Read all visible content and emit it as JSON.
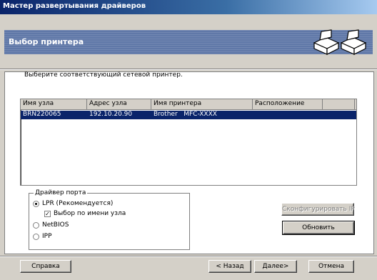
{
  "window": {
    "title": "Мастер развертывания драйверов"
  },
  "banner": {
    "title": "Выбор принтера",
    "icons": [
      "printer-icon",
      "printer-icon"
    ]
  },
  "instruction": "Выберите соответствующий сетевой принтер.",
  "list": {
    "columns": [
      "Имя узла",
      "Адрес узла",
      "Имя принтера",
      "Расположение",
      ""
    ],
    "rows": [
      {
        "node_name": "BRN220065",
        "node_address": "192.10.20.90",
        "printer_name": "Brother   MFC-XXXX",
        "location": ""
      }
    ],
    "selected_row": 0
  },
  "port_driver": {
    "legend": "Драйвер порта",
    "options": [
      {
        "label": "LPR (Рекомендуется)",
        "selected": true
      },
      {
        "label": "NetBIOS",
        "selected": false
      },
      {
        "label": "IPP",
        "selected": false
      }
    ],
    "checkbox": {
      "label": "Выбор по имени узла",
      "checked": true
    }
  },
  "buttons": {
    "configure_ip": "Сконфигурировать IP",
    "refresh": "Обновить",
    "help": "Справка",
    "back": "< Назад",
    "next": "Далее>",
    "cancel": "Отмена"
  }
}
